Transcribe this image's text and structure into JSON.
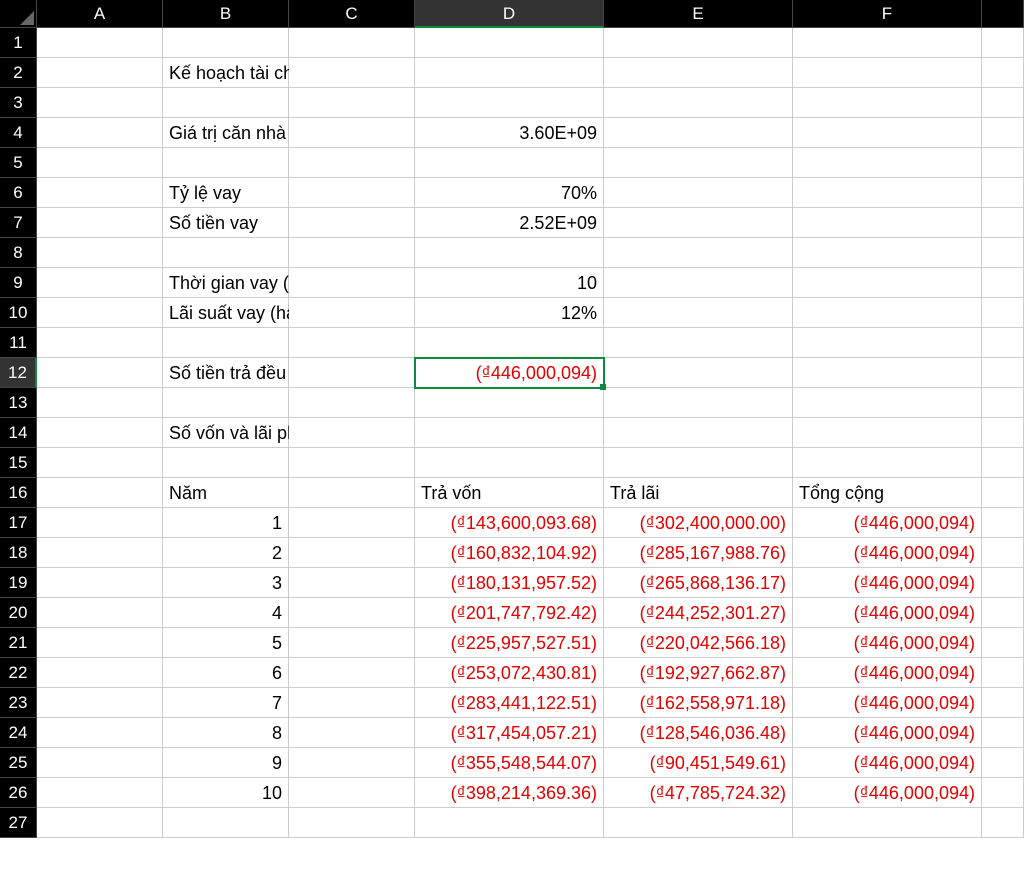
{
  "columns": [
    "A",
    "B",
    "C",
    "D",
    "E",
    "F"
  ],
  "rowCount": 27,
  "selectedCol": "D",
  "selectedRow": 12,
  "labels": {
    "title": "Kế hoạch tài chính khi mua nhà",
    "houseValue": "Giá trị căn nhà",
    "loanRatio": "Tỷ lệ vay",
    "loanAmount": "Số tiền vay",
    "loanYears": "Thời gian vay (năm)",
    "rate": "Lãi suất vay (hàng năm)",
    "annualPay": "Số tiền trả đều hàng năm",
    "scheduleTitle": "Số vốn và lãi phải trả hàng năm",
    "colYear": "Năm",
    "colPrincipal": "Trả vốn",
    "colInterest": "Trả lãi",
    "colTotal": "Tổng cộng"
  },
  "values": {
    "houseValue": "3.60E+09",
    "loanRatio": "70%",
    "loanAmount": "2.52E+09",
    "loanYears": "10",
    "rate": "12%",
    "annualPay": "(₫446,000,094)"
  },
  "schedule": [
    {
      "year": "1",
      "principal": "(₫143,600,093.68)",
      "interest": "(₫302,400,000.00)",
      "total": "(₫446,000,094)"
    },
    {
      "year": "2",
      "principal": "(₫160,832,104.92)",
      "interest": "(₫285,167,988.76)",
      "total": "(₫446,000,094)"
    },
    {
      "year": "3",
      "principal": "(₫180,131,957.52)",
      "interest": "(₫265,868,136.17)",
      "total": "(₫446,000,094)"
    },
    {
      "year": "4",
      "principal": "(₫201,747,792.42)",
      "interest": "(₫244,252,301.27)",
      "total": "(₫446,000,094)"
    },
    {
      "year": "5",
      "principal": "(₫225,957,527.51)",
      "interest": "(₫220,042,566.18)",
      "total": "(₫446,000,094)"
    },
    {
      "year": "6",
      "principal": "(₫253,072,430.81)",
      "interest": "(₫192,927,662.87)",
      "total": "(₫446,000,094)"
    },
    {
      "year": "7",
      "principal": "(₫283,441,122.51)",
      "interest": "(₫162,558,971.18)",
      "total": "(₫446,000,094)"
    },
    {
      "year": "8",
      "principal": "(₫317,454,057.21)",
      "interest": "(₫128,546,036.48)",
      "total": "(₫446,000,094)"
    },
    {
      "year": "9",
      "principal": "(₫355,548,544.07)",
      "interest": "(₫90,451,549.61)",
      "total": "(₫446,000,094)"
    },
    {
      "year": "10",
      "principal": "(₫398,214,369.36)",
      "interest": "(₫47,785,724.32)",
      "total": "(₫446,000,094)"
    }
  ]
}
